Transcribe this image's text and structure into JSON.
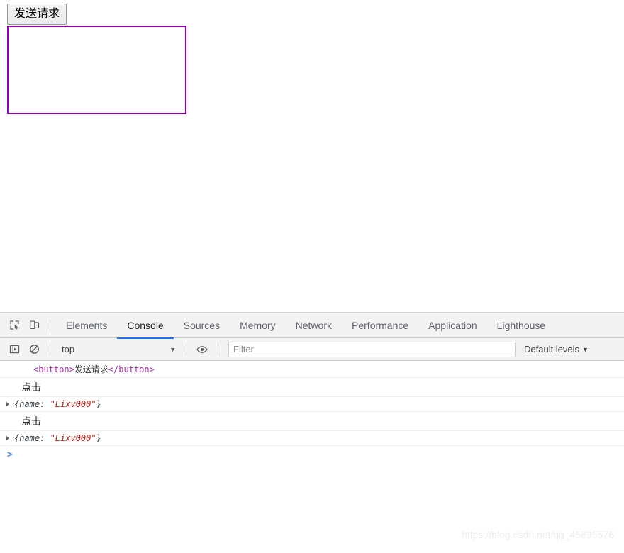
{
  "page": {
    "send_button_label": "发送请求",
    "result_box_border_color": "#9400b0"
  },
  "devtools": {
    "icons": {
      "inspect": "inspect-element-icon",
      "device": "device-toolbar-icon",
      "sidebar": "console-sidebar-icon",
      "clear": "clear-console-icon",
      "eye": "live-expression-icon"
    },
    "tabs": [
      {
        "label": "Elements",
        "active": false
      },
      {
        "label": "Console",
        "active": true
      },
      {
        "label": "Sources",
        "active": false
      },
      {
        "label": "Memory",
        "active": false
      },
      {
        "label": "Network",
        "active": false
      },
      {
        "label": "Performance",
        "active": false
      },
      {
        "label": "Application",
        "active": false
      },
      {
        "label": "Lighthouse",
        "active": false
      }
    ],
    "active_tab": "Console",
    "accent_color": "#1a73e8",
    "context": {
      "selected": "top",
      "caret": "▼"
    },
    "filter": {
      "value": "",
      "placeholder": "Filter"
    },
    "levels": {
      "label": "Default levels",
      "caret": "▼"
    },
    "console_rows": [
      {
        "kind": "html",
        "open_tag": "<button>",
        "inner_text": "发送请求",
        "close_tag": "</button>"
      },
      {
        "kind": "text",
        "text": "点击"
      },
      {
        "kind": "object",
        "triangle": "▶",
        "prefix": "{name: ",
        "value": "\"Lixv000\"",
        "suffix": "}"
      },
      {
        "kind": "text",
        "text": "点击"
      },
      {
        "kind": "object",
        "triangle": "▶",
        "prefix": "{name: ",
        "value": "\"Lixv000\"",
        "suffix": "}"
      }
    ],
    "prompt": {
      "caret": ">",
      "value": ""
    }
  },
  "watermark": {
    "text": "https://blog.csdn.net/qq_45895576"
  }
}
